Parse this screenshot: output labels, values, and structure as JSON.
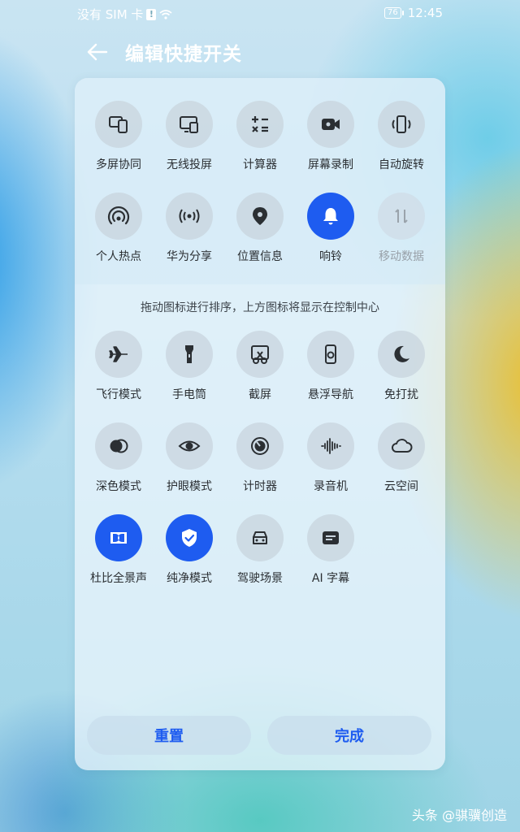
{
  "status_bar": {
    "carrier": "没有 SIM 卡",
    "battery": "76",
    "time": "12:45"
  },
  "header": {
    "title": "编辑快捷开关"
  },
  "active_tiles": [
    {
      "label": "多屏协同",
      "icon": "multi-screen-icon",
      "state": "off"
    },
    {
      "label": "无线投屏",
      "icon": "wireless-projection-icon",
      "state": "off"
    },
    {
      "label": "计算器",
      "icon": "calculator-icon",
      "state": "off"
    },
    {
      "label": "屏幕录制",
      "icon": "screen-record-icon",
      "state": "off"
    },
    {
      "label": "自动旋转",
      "icon": "auto-rotate-icon",
      "state": "off"
    },
    {
      "label": "个人热点",
      "icon": "hotspot-icon",
      "state": "off"
    },
    {
      "label": "华为分享",
      "icon": "huawei-share-icon",
      "state": "off"
    },
    {
      "label": "位置信息",
      "icon": "location-pin-icon",
      "state": "off"
    },
    {
      "label": "响铃",
      "icon": "bell-icon",
      "state": "on"
    },
    {
      "label": "移动数据",
      "icon": "mobile-data-icon",
      "state": "disabled"
    }
  ],
  "hint": "拖动图标进行排序，上方图标将显示在控制中心",
  "available_tiles": [
    {
      "label": "飞行模式",
      "icon": "airplane-icon",
      "state": "off"
    },
    {
      "label": "手电筒",
      "icon": "flashlight-icon",
      "state": "off"
    },
    {
      "label": "截屏",
      "icon": "screenshot-icon",
      "state": "off"
    },
    {
      "label": "悬浮导航",
      "icon": "floating-nav-icon",
      "state": "off"
    },
    {
      "label": "免打扰",
      "icon": "moon-icon",
      "state": "off"
    },
    {
      "label": "深色模式",
      "icon": "dark-mode-icon",
      "state": "off"
    },
    {
      "label": "护眼模式",
      "icon": "eye-icon",
      "state": "off"
    },
    {
      "label": "计时器",
      "icon": "timer-icon",
      "state": "off"
    },
    {
      "label": "录音机",
      "icon": "recorder-icon",
      "state": "off"
    },
    {
      "label": "云空间",
      "icon": "cloud-icon",
      "state": "off"
    },
    {
      "label": "杜比全景声",
      "icon": "dolby-icon",
      "state": "on"
    },
    {
      "label": "纯净模式",
      "icon": "shield-check-icon",
      "state": "on"
    },
    {
      "label": "驾驶场景",
      "icon": "car-icon",
      "state": "off"
    },
    {
      "label": "AI 字幕",
      "icon": "subtitles-icon",
      "state": "off"
    }
  ],
  "buttons": {
    "reset": "重置",
    "done": "完成"
  },
  "watermark": "头条 @骐骥创造",
  "colors": {
    "accent": "#1e5cf0"
  }
}
